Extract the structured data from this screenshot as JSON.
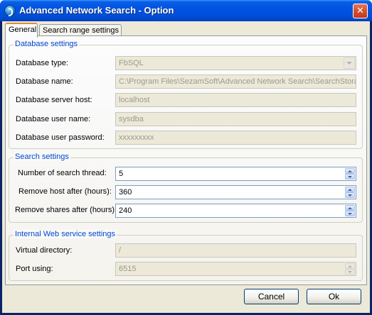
{
  "window": {
    "title": "Advanced Network Search - Option",
    "close_glyph": "✕"
  },
  "tabs": [
    {
      "label": "General",
      "active": true
    },
    {
      "label": "Search range settings",
      "active": false
    }
  ],
  "database_settings": {
    "title": "Database settings",
    "type_label": "Database type:",
    "type_value": "FbSQL",
    "name_label": "Database name:",
    "name_value": "C:\\Program Files\\SezamSoft\\Advanced Network Search\\SearchStora",
    "host_label": "Database server host:",
    "host_value": "localhost",
    "user_label": "Database user name:",
    "user_value": "sysdba",
    "password_label": "Database user password:",
    "password_value": "xxxxxxxxx"
  },
  "search_settings": {
    "title": "Search settings",
    "threads_label": "Number of search thread:",
    "threads_value": "5",
    "remove_host_label": "Remove host after (hours):",
    "remove_host_value": "360",
    "remove_shares_label": "Remove shares after (hours):",
    "remove_shares_value": "240"
  },
  "web_service_settings": {
    "title": "Internal Web service settings",
    "vdir_label": "Virtual directory:",
    "vdir_value": "/",
    "port_label": "Port using:",
    "port_value": "6515"
  },
  "buttons": {
    "cancel": "Cancel",
    "ok": "Ok"
  },
  "icons": {
    "app": "sezamsoft-logo-icon",
    "close": "close-icon",
    "combo": "chevron-down-icon",
    "spin": "spin-arrows-icon"
  },
  "colors": {
    "titlebar": "#0053e1",
    "group_title": "#0046d5",
    "active_tab_accent": "#e68b2c",
    "dialog_bg": "#ece9d8"
  }
}
